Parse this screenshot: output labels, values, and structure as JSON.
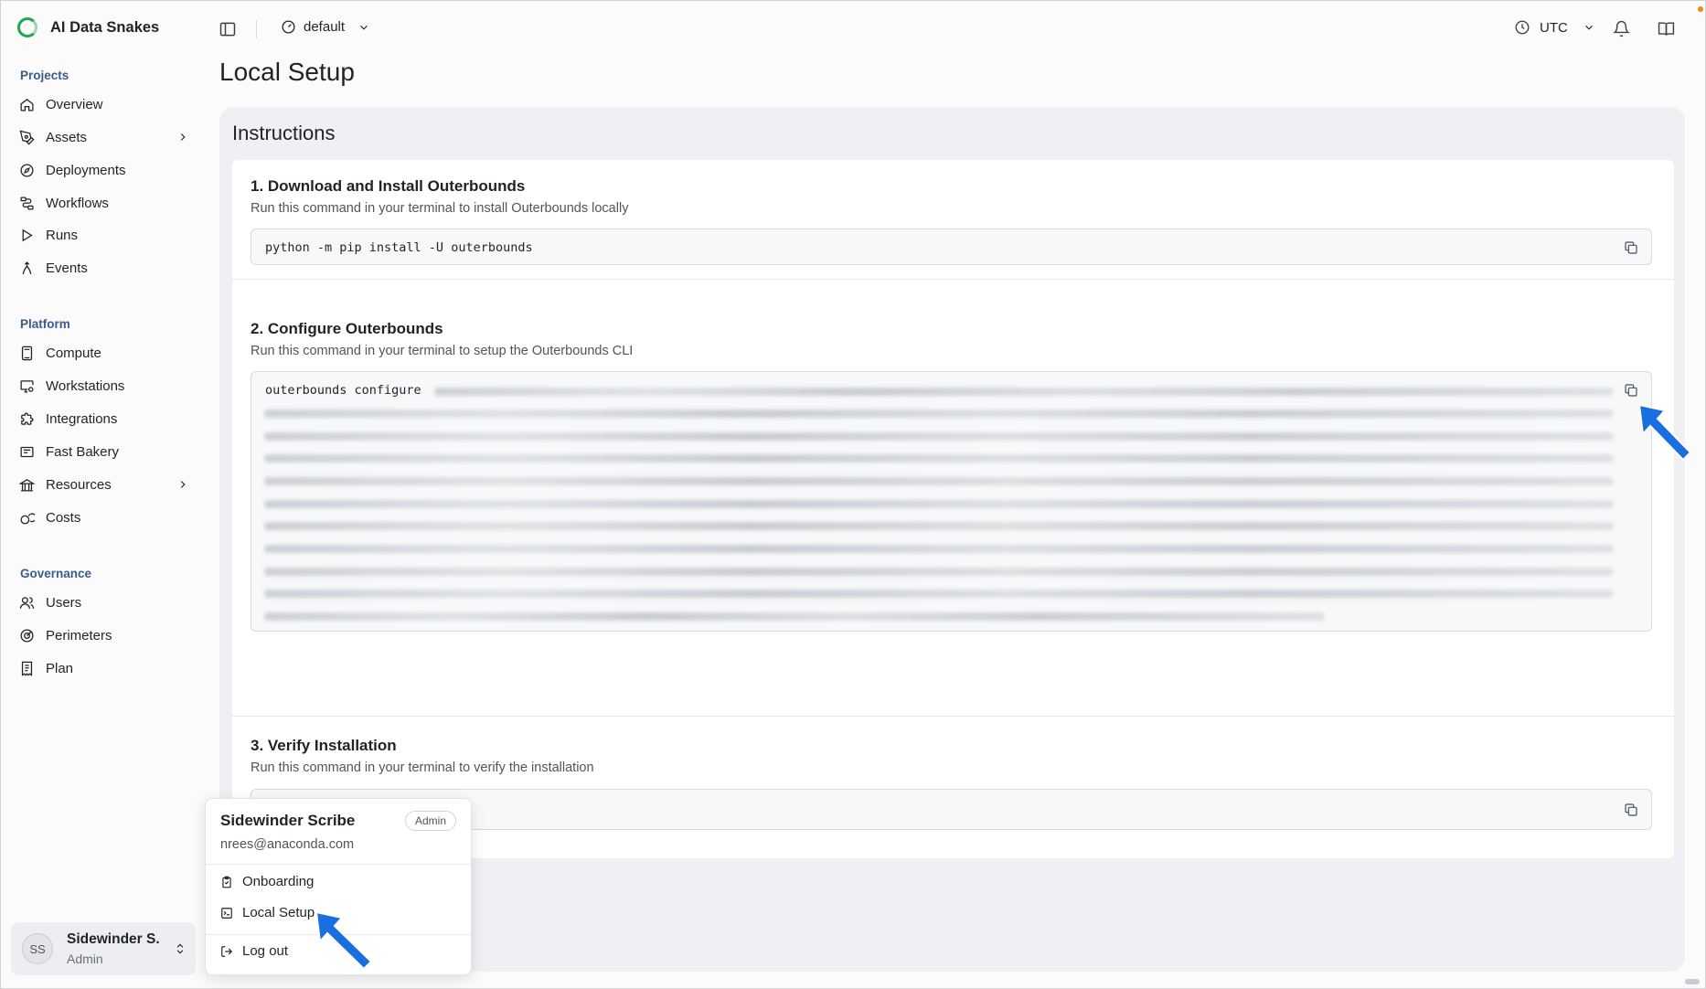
{
  "app": {
    "name": "AI Data Snakes",
    "workspace": "default",
    "timezone": "UTC"
  },
  "sidebar": {
    "sections": [
      {
        "title": "Projects",
        "items": [
          {
            "label": "Overview",
            "icon": "home-icon"
          },
          {
            "label": "Assets",
            "icon": "pen-tool-icon",
            "chevron": true
          },
          {
            "label": "Deployments",
            "icon": "compass-icon"
          },
          {
            "label": "Workflows",
            "icon": "workflow-icon"
          },
          {
            "label": "Runs",
            "icon": "play-icon"
          },
          {
            "label": "Events",
            "icon": "event-branch-icon"
          }
        ]
      },
      {
        "title": "Platform",
        "items": [
          {
            "label": "Compute",
            "icon": "calculator-icon"
          },
          {
            "label": "Workstations",
            "icon": "monitor-settings-icon"
          },
          {
            "label": "Integrations",
            "icon": "puzzle-icon"
          },
          {
            "label": "Fast Bakery",
            "icon": "package-icon"
          },
          {
            "label": "Resources",
            "icon": "landmark-icon",
            "chevron": true
          },
          {
            "label": "Costs",
            "icon": "coins-icon"
          }
        ]
      },
      {
        "title": "Governance",
        "items": [
          {
            "label": "Users",
            "icon": "users-icon"
          },
          {
            "label": "Perimeters",
            "icon": "radar-icon"
          },
          {
            "label": "Plan",
            "icon": "receipt-icon"
          }
        ]
      }
    ],
    "user": {
      "initials": "SS",
      "name": "Sidewinder S.",
      "role": "Admin"
    }
  },
  "page": {
    "title": "Local Setup",
    "panel_title": "Instructions",
    "steps": [
      {
        "title": "1. Download and Install Outerbounds",
        "description": "Run this command in your terminal to install Outerbounds locally",
        "command": "python -m pip install -U outerbounds"
      },
      {
        "title": "2. Configure Outerbounds",
        "description": "Run this command in your terminal to setup the Outerbounds CLI",
        "command": "outerbounds configure"
      },
      {
        "title": "3. Verify Installation",
        "description": "Run this command in your terminal to verify the installation",
        "command": ""
      }
    ]
  },
  "popup": {
    "name": "Sidewinder Scribe",
    "badge": "Admin",
    "email": "nrees@anaconda.com",
    "items": [
      {
        "label": "Onboarding",
        "icon": "clipboard-icon"
      },
      {
        "label": "Local Setup",
        "icon": "terminal-icon"
      },
      {
        "label": "Log out",
        "icon": "logout-icon"
      }
    ]
  },
  "colors": {
    "accent": "#3c5a8a",
    "brand": "#1fa84b",
    "annotation_arrow": "#1a6fe0",
    "notification_dot": "#f08a12"
  }
}
